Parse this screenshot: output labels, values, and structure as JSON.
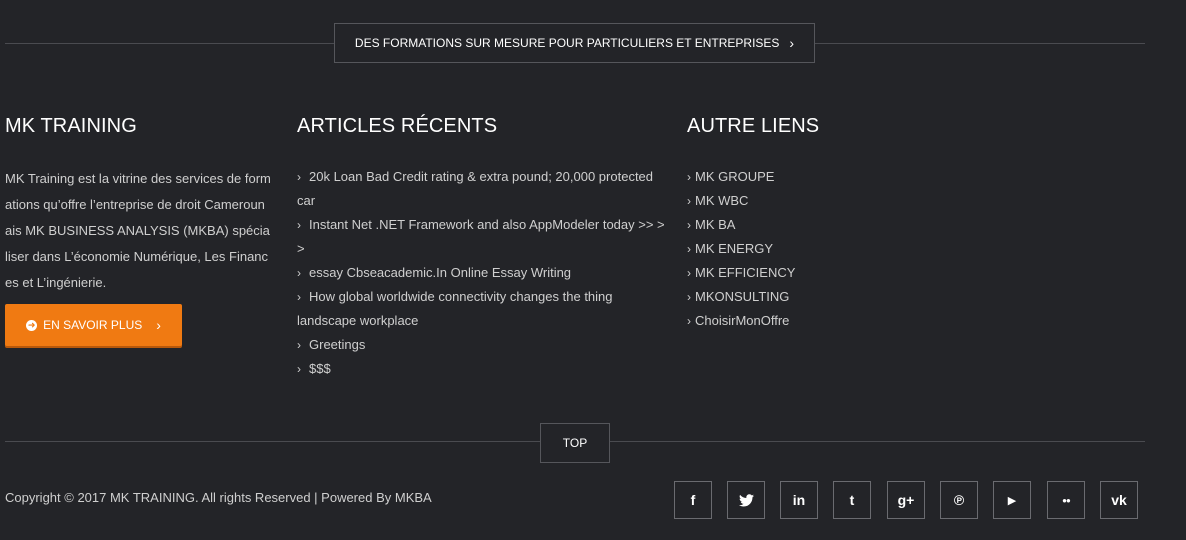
{
  "banner": {
    "label": "DES FORMATIONS SUR MESURE POUR PARTICULIERS ET ENTREPRISES",
    "chevron": "›"
  },
  "about": {
    "title": "MK TRAINING",
    "text": "MK Training est la vitrine des services de formations qu’offre l’entreprise de droit Camerounais MK BUSINESS ANALYSIS (MKBA) spécialiser dans L’économie Numérique, Les Finances et L’ingénierie.",
    "button_label": "EN SAVOIR PLUS",
    "button_chevron": "›"
  },
  "articles": {
    "title": "ARTICLES RÉCENTS",
    "items": [
      "20k Loan Bad Credit rating & extra pound; 20,000 protected car",
      "Instant Net .NET Framework and also AppModeler today >> > >",
      "essay Cbseacademic.In Online Essay Writing",
      "How global worldwide connectivity changes the thing landscape workplace",
      "Greetings",
      "$$$"
    ]
  },
  "links": {
    "title": "AUTRE LIENS",
    "items": [
      "MK GROUPE",
      "MK WBC",
      "MK BA",
      "MK ENERGY",
      "MK EFFICIENCY",
      "MKONSULTING",
      "ChoisirMonOffre"
    ]
  },
  "top_button": {
    "label": "TOP"
  },
  "footer": {
    "copyright": "Copyright © 2017 MK TRAINING. All rights Reserved | Powered By MKBA"
  },
  "social": [
    {
      "name": "facebook",
      "glyph": "f"
    },
    {
      "name": "twitter",
      "glyph": "🐦"
    },
    {
      "name": "linkedin",
      "glyph": "in"
    },
    {
      "name": "tumblr",
      "glyph": "t"
    },
    {
      "name": "google-plus",
      "glyph": "g+"
    },
    {
      "name": "pinterest",
      "glyph": "℗"
    },
    {
      "name": "youtube",
      "glyph": "▶"
    },
    {
      "name": "flickr",
      "glyph": "●●"
    },
    {
      "name": "vk",
      "glyph": "vk"
    }
  ]
}
